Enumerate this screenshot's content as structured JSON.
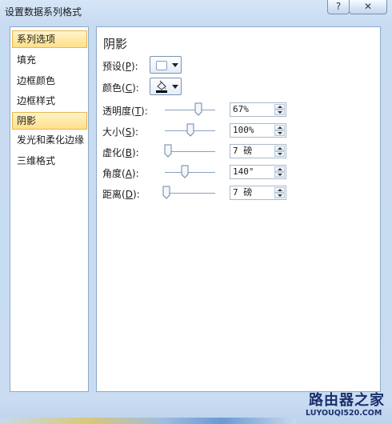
{
  "window": {
    "title": "设置数据系列格式",
    "help_label": "?",
    "close_label": "✕"
  },
  "sidebar": {
    "items": [
      {
        "label": "系列选项",
        "active": true
      },
      {
        "label": "填充",
        "active": false
      },
      {
        "label": "边框颜色",
        "active": false
      },
      {
        "label": "边框样式",
        "active": false
      },
      {
        "label": "阴影",
        "active": true
      },
      {
        "label": "发光和柔化边缘",
        "active": false
      },
      {
        "label": "三维格式",
        "active": false
      }
    ]
  },
  "panel": {
    "title": "阴影",
    "preset": {
      "label": "预设",
      "key": "P"
    },
    "color": {
      "label": "颜色",
      "key": "C",
      "icon": "paint-bucket-icon",
      "swatch_color": "#000000"
    },
    "sliders": [
      {
        "label": "透明度",
        "key": "T",
        "value": "67%",
        "level": 0.67
      },
      {
        "label": "大小",
        "key": "S",
        "value": "100%",
        "level": 0.5
      },
      {
        "label": "虚化",
        "key": "B",
        "value": "7 磅",
        "level": 0.07
      },
      {
        "label": "角度",
        "key": "A",
        "value": "140°",
        "level": 0.39
      },
      {
        "label": "距离",
        "key": "D",
        "value": "7 磅",
        "level": 0.035
      }
    ]
  },
  "watermark": {
    "name": "路由器之家",
    "url": "LUYOUQI520.COM"
  }
}
